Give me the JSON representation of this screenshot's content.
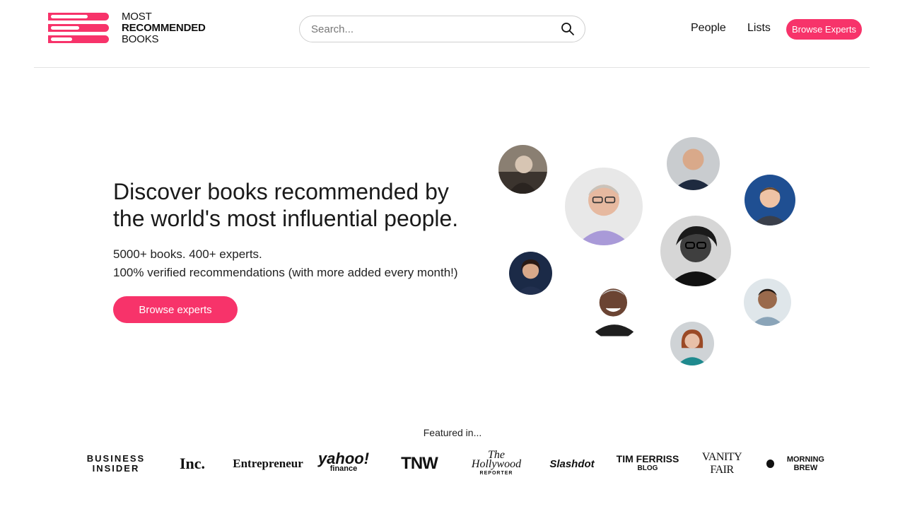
{
  "header": {
    "logo": {
      "line1": "MOST",
      "line2": "RECOMMENDED",
      "line3": "BOOKS"
    },
    "search": {
      "placeholder": "Search..."
    },
    "nav": {
      "people": "People",
      "lists": "Lists",
      "browse": "Browse Experts"
    }
  },
  "hero": {
    "title_line1": "Discover books recommended by",
    "title_line2": "the world's most influential people.",
    "sub_line1": "5000+ books. 400+ experts.",
    "sub_line2": "100% verified recommendations (with more added every month!)",
    "cta": "Browse experts"
  },
  "featured": {
    "label": "Featured in...",
    "publications": [
      {
        "name": "BUSINESS INSIDER",
        "line1": "BUSINESS",
        "line2": "INSIDER"
      },
      {
        "name": "Inc."
      },
      {
        "name": "Entrepreneur"
      },
      {
        "name": "yahoo! finance",
        "line1": "yahoo!",
        "line2": "finance"
      },
      {
        "name": "TNW"
      },
      {
        "name": "The Hollywood Reporter",
        "line1": "The Hollywood",
        "line2": "REPORTER"
      },
      {
        "name": "Slashdot"
      },
      {
        "name": "TIM FERRISS BLOG",
        "line1": "TIM FERRISS",
        "line2": "BLOG"
      },
      {
        "name": "VANITY FAIR"
      },
      {
        "name": "MORNING BREW"
      }
    ]
  },
  "colors": {
    "accent": "#f7336a",
    "text": "#1a1a1a",
    "divider": "#e2e2e2"
  }
}
